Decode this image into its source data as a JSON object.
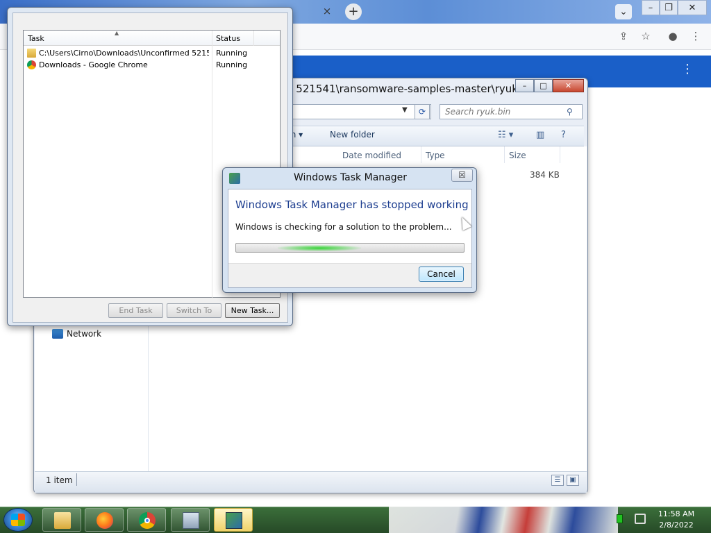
{
  "chrome": {
    "tab_close": "×",
    "new_tab": "+",
    "menu_dots": "⋮"
  },
  "explorer": {
    "title": "d 521541\\ransomware-samples-master\\ryuk.bin",
    "search_placeholder": "Search ryuk.bin",
    "cmd_share": "th ▾",
    "cmd_new_folder": "New folder",
    "columns": [
      "Date modified",
      "Type",
      "Size"
    ],
    "file_size": "384 KB",
    "nav_network": "Network",
    "status_items": "1 item"
  },
  "taskmgr": {
    "col_task": "Task",
    "col_status": "Status",
    "rows": [
      {
        "task": "C:\\Users\\Cirno\\Downloads\\Unconfirmed 521541...",
        "status": "Running",
        "icon": "folder-icon"
      },
      {
        "task": "Downloads - Google Chrome",
        "status": "Running",
        "icon": "chrome-icon"
      }
    ],
    "buttons": {
      "end_task": "End Task",
      "switch_to": "Switch To",
      "new_task": "New Task..."
    }
  },
  "dialog": {
    "title": "Windows Task Manager",
    "heading": "Windows Task Manager has stopped working",
    "message": "Windows is checking for a solution to the problem...",
    "cancel": "Cancel",
    "close": "☒"
  },
  "taskbar": {
    "clock_time": "11:58 AM",
    "clock_date": "2/8/2022"
  }
}
